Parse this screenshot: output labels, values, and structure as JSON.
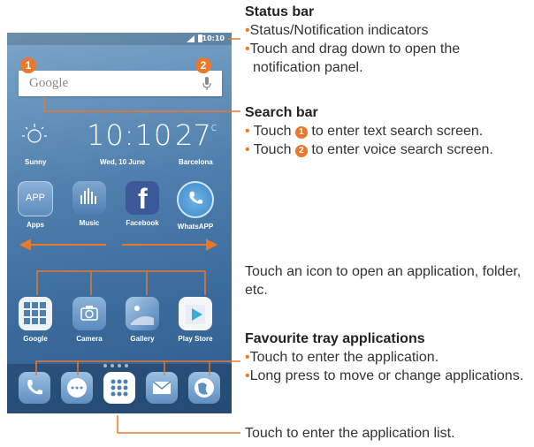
{
  "phone": {
    "status_time": "10:10",
    "search_logo": "Google",
    "badge1": "1",
    "badge2": "2",
    "weather_label": "Sunny",
    "clock_time": "10:10",
    "date_label": "Wed, 10 June",
    "temperature": "27",
    "temp_unit": "c",
    "city_label": "Barcelona",
    "row1_apps": [
      "Apps",
      "Music",
      "Facebook",
      "WhatsAPP"
    ],
    "apps_icon_text": "APP",
    "row2_apps": [
      "Google",
      "Camera",
      "Gallery",
      "Play Store"
    ],
    "dock_icons": [
      "phone-icon",
      "messaging-icon",
      "app-drawer-icon",
      "email-icon",
      "browser-icon"
    ]
  },
  "annotations": {
    "status_bar": {
      "heading": "Status bar",
      "bullets": [
        "Status/Notification indicators",
        "Touch and drag down to open the notification panel."
      ]
    },
    "search_bar": {
      "heading": "Search bar",
      "bullet1_pre": "Touch",
      "bullet1_num": "1",
      "bullet1_post": "to enter text search screen.",
      "bullet2_pre": "Touch",
      "bullet2_num": "2",
      "bullet2_post": "to enter voice search screen."
    },
    "icon_note": "Touch an icon to open an application, folder, etc.",
    "favourite": {
      "heading": "Favourite tray applications",
      "bullets": [
        "Touch to enter the application.",
        "Long press to move or change applications."
      ]
    },
    "app_list_note": "Touch to enter the application list."
  },
  "colors": {
    "accent": "#e8782c"
  }
}
